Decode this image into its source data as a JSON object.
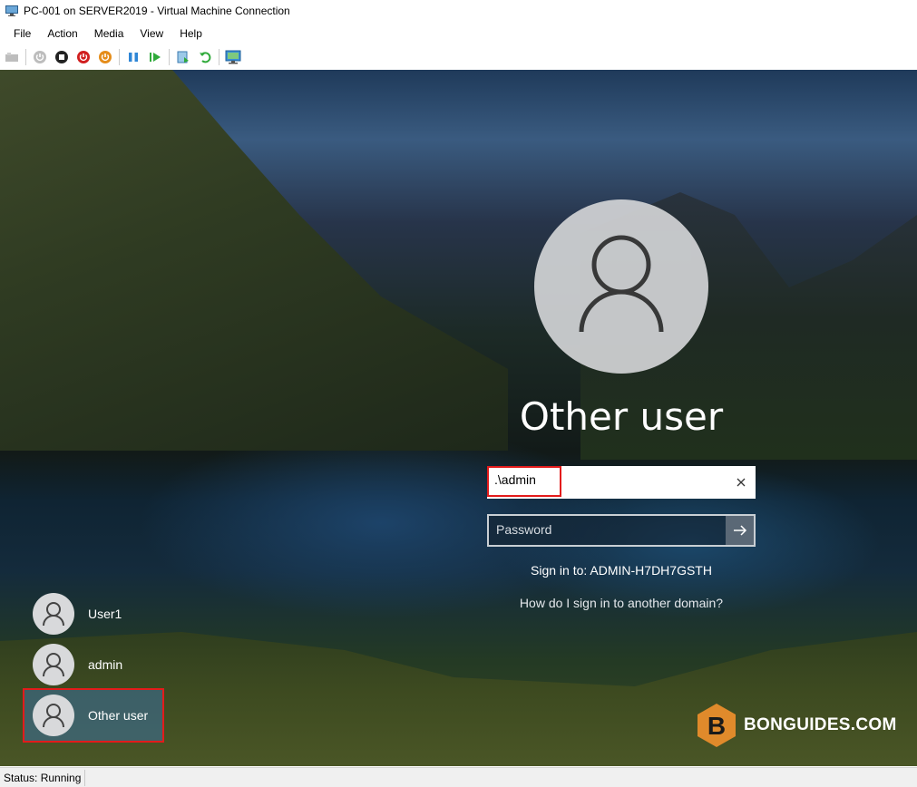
{
  "window": {
    "title": "PC-001 on SERVER2019 - Virtual Machine Connection",
    "icon": "vm-connection-icon"
  },
  "menu": [
    "File",
    "Action",
    "Media",
    "View",
    "Help"
  ],
  "toolbar": {
    "buttons": [
      "ctrl-alt-del-icon",
      "start-icon",
      "turn-off-icon",
      "shutdown-icon",
      "save-icon",
      "pause-icon",
      "reset-icon",
      "checkpoint-icon",
      "revert-icon",
      "enhanced-session-icon"
    ]
  },
  "login": {
    "title": "Other user",
    "username_value": ".\\admin",
    "password_placeholder": "Password",
    "sign_in_to": "Sign in to: ADMIN-H7DH7GSTH",
    "other_domain_link": "How do I sign in to another domain?"
  },
  "users": [
    {
      "label": "User1",
      "selected": false
    },
    {
      "label": "admin",
      "selected": false
    },
    {
      "label": "Other user",
      "selected": true
    }
  ],
  "watermark": {
    "text": "BONGUIDES.COM",
    "logo_letter": "B"
  },
  "status": {
    "text": "Status: Running"
  },
  "colors": {
    "highlight": "#e31b1b",
    "watermark_logo": "#e08a2b"
  }
}
